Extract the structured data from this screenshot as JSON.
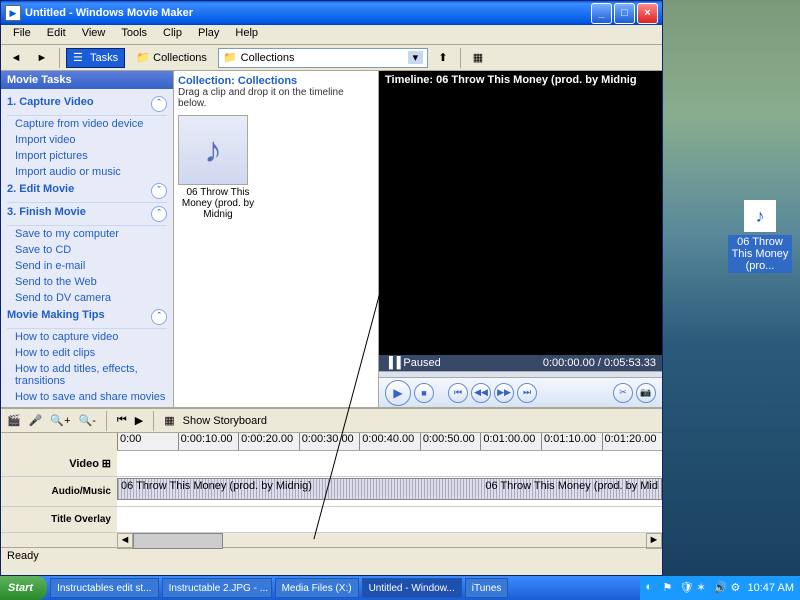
{
  "window": {
    "title": "Untitled - Windows Movie Maker"
  },
  "menu": [
    "File",
    "Edit",
    "View",
    "Tools",
    "Clip",
    "Play",
    "Help"
  ],
  "toolbar": {
    "tasks": "Tasks",
    "collections": "Collections",
    "combo_value": "Collections"
  },
  "taskpane": {
    "header": "Movie Tasks",
    "sections": [
      {
        "title": "1. Capture Video",
        "links": [
          "Capture from video device",
          "Import video",
          "Import pictures",
          "Import audio or music"
        ]
      },
      {
        "title": "2. Edit Movie",
        "links": []
      },
      {
        "title": "3. Finish Movie",
        "links": [
          "Save to my computer",
          "Save to CD",
          "Send in e-mail",
          "Send to the Web",
          "Send to DV camera"
        ]
      },
      {
        "title": "Movie Making Tips",
        "links": [
          "How to capture video",
          "How to edit clips",
          "How to add titles, effects, transitions",
          "How to save and share movies"
        ]
      }
    ]
  },
  "collection": {
    "title": "Collection: Collections",
    "subtitle": "Drag a clip and drop it on the timeline below.",
    "clip_name": "06 Throw This Money (prod. by Midnig"
  },
  "preview": {
    "title": "Timeline: 06 Throw This Money (prod. by Midnig",
    "status": "Paused",
    "time": "0:00:00.00 / 0:05:53.33"
  },
  "timeline": {
    "storyboard_btn": "Show Storyboard",
    "ticks": [
      "0:00",
      "0:00:10.00",
      "0:00:20.00",
      "0:00:30.00",
      "0:00:40.00",
      "0:00:50.00",
      "0:01:00.00",
      "0:01:10.00",
      "0:01:20.00"
    ],
    "rows": {
      "video": "Video",
      "audio": "Audio/Music",
      "title": "Title Overlay"
    },
    "audio_clip": "06 Throw This Money (prod. by Midnig)",
    "audio_clip2": "06 Throw This Money (prod. by Mid"
  },
  "statusbar": "Ready",
  "desktop_icon": "06 Throw This Money (pro...",
  "taskbar": {
    "start": "Start",
    "items": [
      "Instructables edit st...",
      "Instructable 2.JPG - ...",
      "Media Files (X:)",
      "Untitled - Window...",
      "iTunes"
    ],
    "clock": "10:47 AM"
  }
}
